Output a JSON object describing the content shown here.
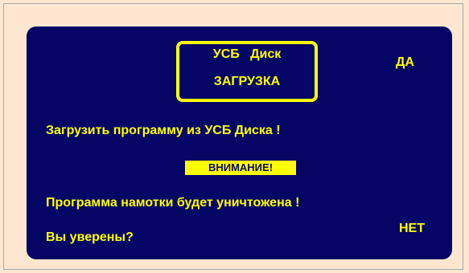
{
  "dialog": {
    "title_line1": "УСБ   Диск",
    "title_line2": "ЗАГРУЗКА",
    "yes_label": "ДА",
    "no_label": "НЕТ",
    "message": "Загрузить программу из УСБ Диска !",
    "warning_label": "ВНИМАНИЕ!",
    "consequence": "Программа намотки будет уничтожена !",
    "question": "Вы уверены?"
  },
  "colors": {
    "background": "#fde7d1",
    "dialog_bg": "#050566",
    "accent": "#ffff00"
  }
}
